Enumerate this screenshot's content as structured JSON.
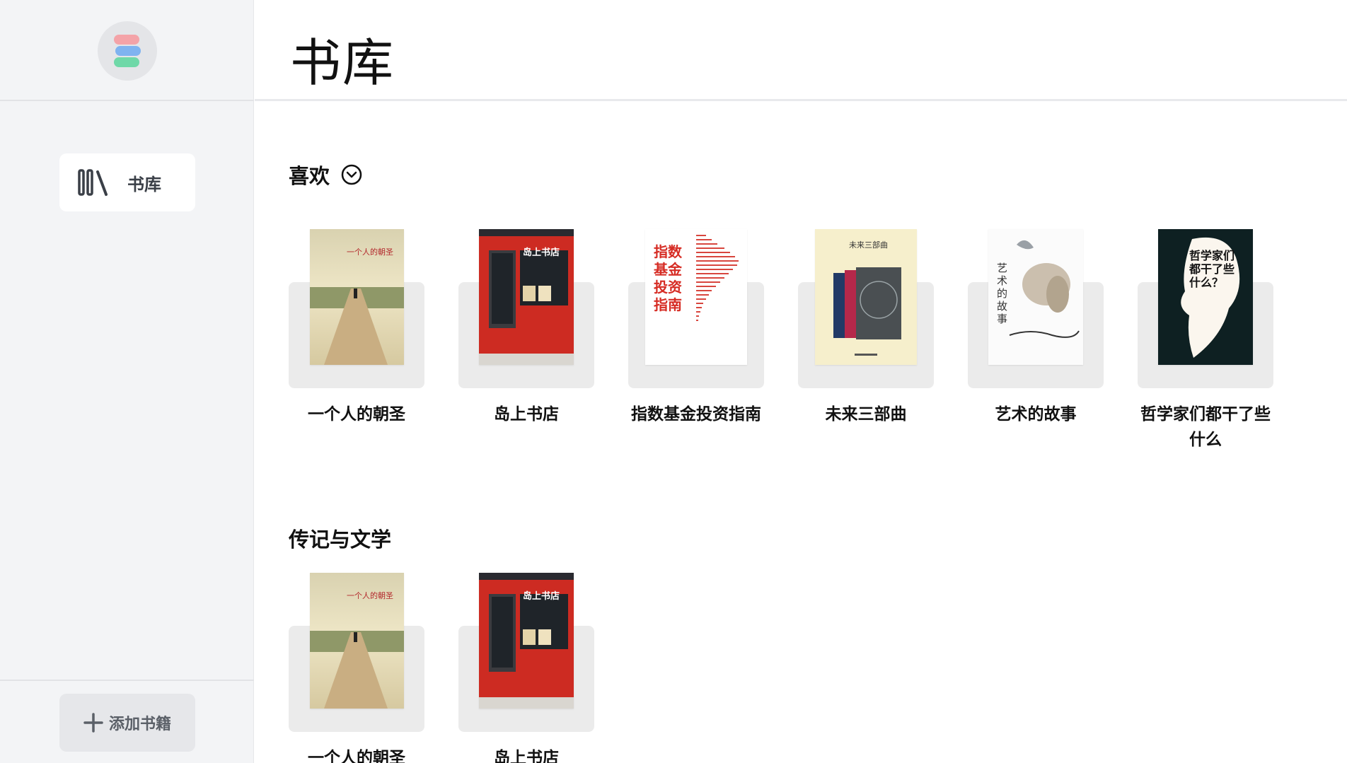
{
  "sidebar": {
    "nav_items": [
      {
        "label": "书库",
        "icon": "library-icon",
        "active": true
      }
    ],
    "add_button": {
      "label": "添加书籍",
      "icon": "plus-icon"
    }
  },
  "main": {
    "page_title": "书库",
    "sections": [
      {
        "title": "喜欢",
        "books": [
          {
            "title": "一个人的朝圣",
            "cover_text": "一个人的朝圣"
          },
          {
            "title": "岛上书店",
            "cover_text": "岛上书店"
          },
          {
            "title": "指数基金投资指南",
            "cover_text": "指数基金投资指南"
          },
          {
            "title": "未来三部曲",
            "cover_text": "未来三部曲"
          },
          {
            "title": "艺术的故事",
            "cover_text": "艺术的故事"
          },
          {
            "title": "哲学家们都干了些什么",
            "cover_text": "哲学家们都干了些什么？"
          }
        ]
      },
      {
        "title": "传记与文学",
        "books": [
          {
            "title": "一个人的朝圣",
            "cover_text": "一个人的朝圣"
          },
          {
            "title": "岛上书店",
            "cover_text": "岛上书店"
          }
        ]
      }
    ]
  }
}
